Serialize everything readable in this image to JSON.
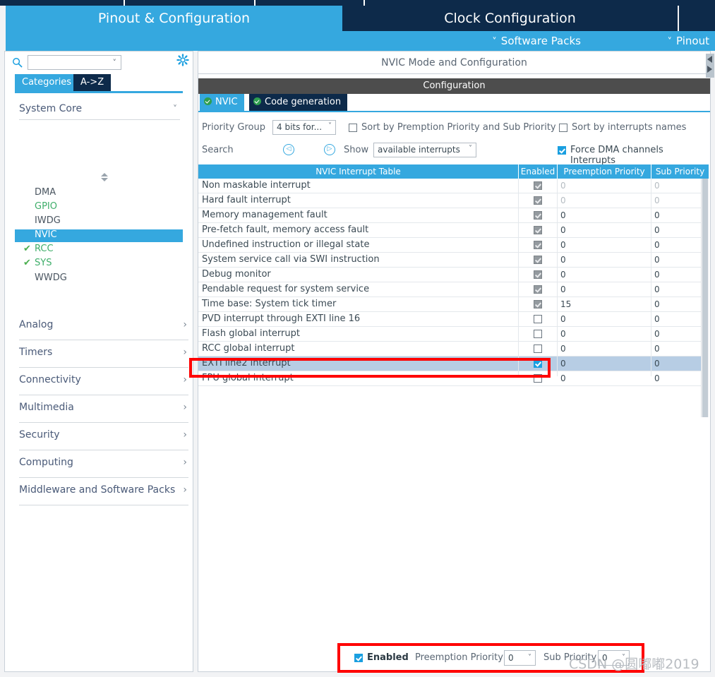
{
  "window": {
    "main_tabs": [
      {
        "label": "Pinout & Configuration",
        "selected": true
      },
      {
        "label": "Clock Configuration",
        "selected": false
      },
      {
        "label": "",
        "selected": false
      }
    ],
    "sub_bar": [
      {
        "label": "Software Packs",
        "icon": "chevron-down-icon"
      },
      {
        "label": "Pinout",
        "icon": "chevron-down-icon"
      }
    ]
  },
  "sidebar": {
    "search": {
      "value": "",
      "placeholder": "",
      "icon": "search-icon",
      "dropdown_icon": "chevron-down-icon"
    },
    "gear_icon": "gear-icon",
    "view_tabs": [
      {
        "label": "Categories",
        "selected": true
      },
      {
        "label": "A->Z",
        "selected": false
      }
    ],
    "groups": [
      {
        "label": "System Core",
        "expanded": true,
        "chevron": "chevron-down-icon",
        "items": [
          {
            "label": "DMA",
            "state": "normal",
            "selected": false
          },
          {
            "label": "GPIO",
            "state": "configured",
            "selected": false
          },
          {
            "label": "IWDG",
            "state": "normal",
            "selected": false
          },
          {
            "label": "NVIC",
            "state": "normal",
            "selected": true
          },
          {
            "label": "RCC",
            "state": "checked",
            "selected": false
          },
          {
            "label": "SYS",
            "state": "checked",
            "selected": false
          },
          {
            "label": "WWDG",
            "state": "normal",
            "selected": false
          }
        ]
      }
    ],
    "categories": [
      {
        "label": "Analog",
        "chevron": "chevron-right-icon"
      },
      {
        "label": "Timers",
        "chevron": "chevron-right-icon"
      },
      {
        "label": "Connectivity",
        "chevron": "chevron-right-icon"
      },
      {
        "label": "Multimedia",
        "chevron": "chevron-right-icon"
      },
      {
        "label": "Security",
        "chevron": "chevron-right-icon"
      },
      {
        "label": "Computing",
        "chevron": "chevron-right-icon"
      },
      {
        "label": "Middleware and Software Packs",
        "chevron": "chevron-right-icon"
      }
    ]
  },
  "panel": {
    "mode_header": "NVIC Mode and Configuration",
    "config_header": "Configuration",
    "tabs": [
      {
        "label": "NVIC",
        "selected": true,
        "status_icon": "check-circle-icon"
      },
      {
        "label": "Code generation",
        "selected": false,
        "status_icon": "check-circle-icon"
      }
    ],
    "priority_group": {
      "label": "Priority Group",
      "value": "4 bits for...",
      "dropdown_icon": "chevron-down-icon"
    },
    "sort_premption": {
      "label": "Sort by Premption Priority and Sub Priority",
      "checked": false
    },
    "sort_names": {
      "label": "Sort by interrupts names",
      "checked": false
    },
    "search": {
      "label": "Search",
      "prev_icon": "chevron-left-circle-icon",
      "next_icon": "chevron-right-circle-icon"
    },
    "show": {
      "label": "Show",
      "value": "available interrupts",
      "dropdown_icon": "chevron-down-icon"
    },
    "force_dma": {
      "label": "Force DMA channels Interrupts",
      "checked": true
    }
  },
  "table": {
    "headers": [
      "NVIC Interrupt Table",
      "Enabled",
      "Preemption Priority",
      "Sub Priority"
    ],
    "rows": [
      {
        "name": "Non maskable interrupt",
        "enabled": true,
        "readonly": true,
        "preemption": "0",
        "sub": "0",
        "dim": true,
        "selected": false
      },
      {
        "name": "Hard fault interrupt",
        "enabled": true,
        "readonly": true,
        "preemption": "0",
        "sub": "0",
        "dim": true,
        "selected": false
      },
      {
        "name": "Memory management fault",
        "enabled": true,
        "readonly": true,
        "preemption": "0",
        "sub": "0",
        "dim": false,
        "selected": false
      },
      {
        "name": "Pre-fetch fault, memory access fault",
        "enabled": true,
        "readonly": true,
        "preemption": "0",
        "sub": "0",
        "dim": false,
        "selected": false
      },
      {
        "name": "Undefined instruction or illegal state",
        "enabled": true,
        "readonly": true,
        "preemption": "0",
        "sub": "0",
        "dim": false,
        "selected": false
      },
      {
        "name": "System service call via SWI instruction",
        "enabled": true,
        "readonly": true,
        "preemption": "0",
        "sub": "0",
        "dim": false,
        "selected": false
      },
      {
        "name": "Debug monitor",
        "enabled": true,
        "readonly": true,
        "preemption": "0",
        "sub": "0",
        "dim": false,
        "selected": false
      },
      {
        "name": "Pendable request for system service",
        "enabled": true,
        "readonly": true,
        "preemption": "0",
        "sub": "0",
        "dim": false,
        "selected": false
      },
      {
        "name": "Time base: System tick timer",
        "enabled": true,
        "readonly": true,
        "preemption": "15",
        "sub": "0",
        "dim": false,
        "selected": false
      },
      {
        "name": "PVD interrupt through EXTI line 16",
        "enabled": false,
        "readonly": false,
        "preemption": "0",
        "sub": "0",
        "dim": false,
        "selected": false
      },
      {
        "name": "Flash global interrupt",
        "enabled": false,
        "readonly": false,
        "preemption": "0",
        "sub": "0",
        "dim": false,
        "selected": false
      },
      {
        "name": "RCC global interrupt",
        "enabled": false,
        "readonly": false,
        "preemption": "0",
        "sub": "0",
        "dim": false,
        "selected": false
      },
      {
        "name": "EXTI line2 interrupt",
        "enabled": true,
        "readonly": false,
        "preemption": "0",
        "sub": "0",
        "dim": false,
        "selected": true
      },
      {
        "name": "FPU global interrupt",
        "enabled": false,
        "readonly": false,
        "preemption": "0",
        "sub": "0",
        "dim": false,
        "selected": false
      }
    ]
  },
  "bottom": {
    "enabled": {
      "label": "Enabled",
      "checked": true
    },
    "preemption": {
      "label": "Preemption Priority",
      "value": "0",
      "dropdown_icon": "chevron-down-icon"
    },
    "sub": {
      "label": "Sub Priority",
      "value": "0",
      "dropdown_icon": "chevron-down-icon"
    }
  },
  "watermark": "CSDN @圆嘟嘟2019",
  "colors": {
    "accent": "#35a8df",
    "dark": "#0d2a4a",
    "highlight": "#ff0000",
    "row_select": "#b7cde4",
    "ok_green": "#2e9e4f"
  }
}
